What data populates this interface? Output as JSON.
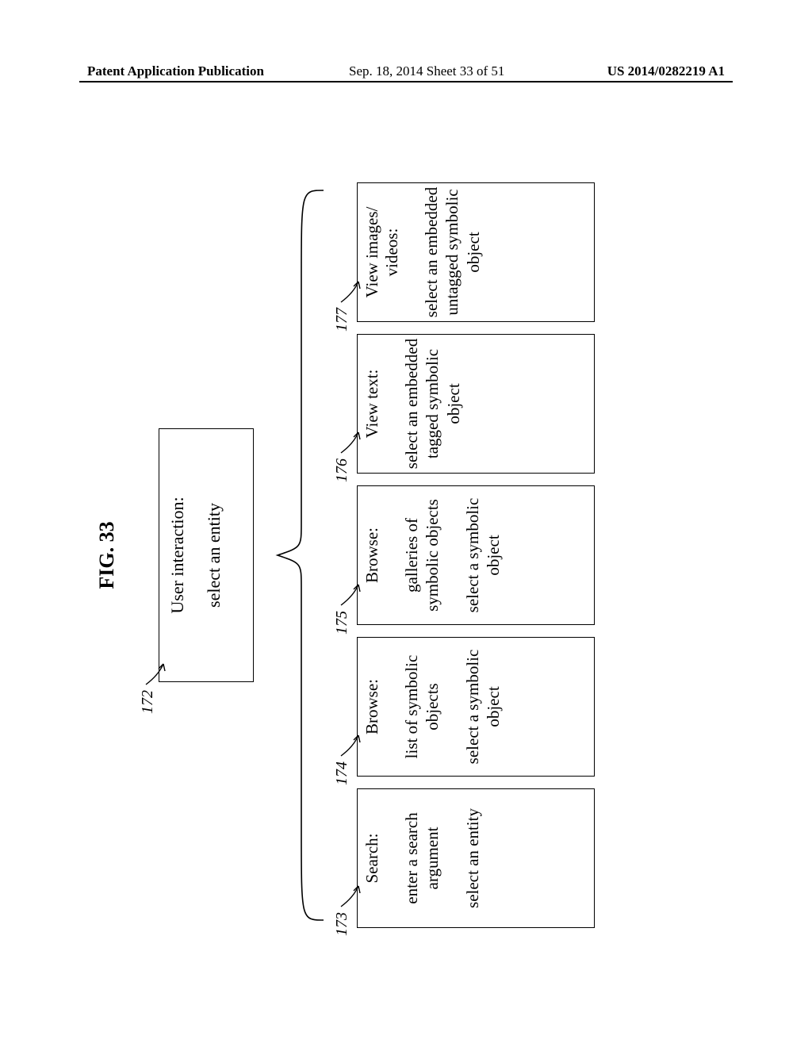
{
  "header": {
    "left": "Patent Application Publication",
    "center": "Sep. 18, 2014  Sheet 33 of 51",
    "right": "US 2014/0282219 A1"
  },
  "figure": {
    "title": "FIG. 33",
    "top": {
      "ref": "172",
      "line1": "User interaction:",
      "line2": "select an entity"
    },
    "children": [
      {
        "ref": "173",
        "title": "Search:",
        "mid": "enter a search argument",
        "bot": "select an entity"
      },
      {
        "ref": "174",
        "title": "Browse:",
        "mid": "list of symbolic objects",
        "bot": "select a symbolic object"
      },
      {
        "ref": "175",
        "title": "Browse:",
        "mid": "galleries of symbolic objects",
        "bot": "select a symbolic object"
      },
      {
        "ref": "176",
        "title": "View text:",
        "mid": "",
        "bot": "select an embedded tagged symbolic object"
      },
      {
        "ref": "177",
        "title": "View images/ videos:",
        "mid": "",
        "bot": "select an embedded untagged symbolic object"
      }
    ]
  }
}
